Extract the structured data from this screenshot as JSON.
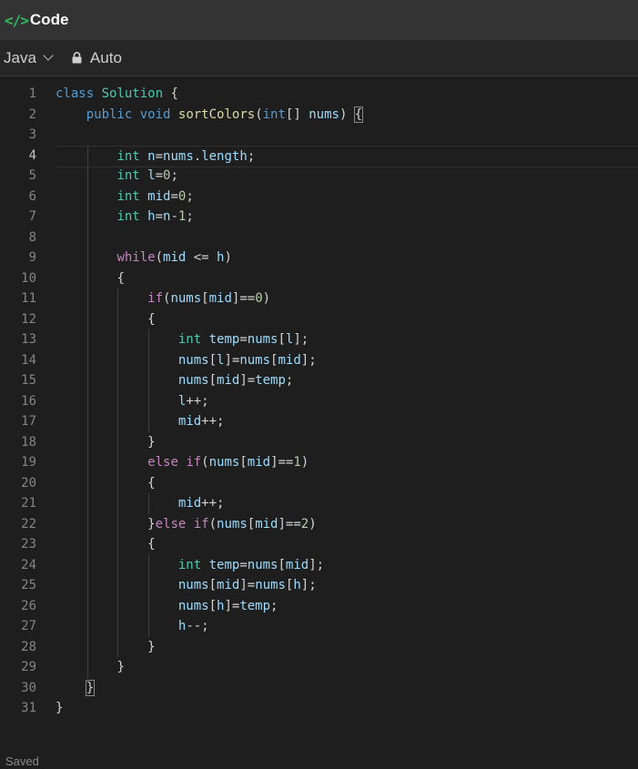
{
  "header": {
    "icon": "code-brackets-icon",
    "icon_glyph": "</>",
    "title": "Code"
  },
  "toolbar": {
    "language": "Java",
    "mode": "Auto"
  },
  "editor": {
    "active_line": 4,
    "lines": [
      {
        "n": "1",
        "indent": 0,
        "tokens": [
          [
            "kw",
            "class"
          ],
          [
            "plain",
            " "
          ],
          [
            "cls",
            "Solution"
          ],
          [
            "plain",
            " {"
          ]
        ]
      },
      {
        "n": "2",
        "indent": 1,
        "tokens": [
          [
            "kw",
            "public"
          ],
          [
            "plain",
            " "
          ],
          [
            "kw",
            "void"
          ],
          [
            "plain",
            " "
          ],
          [
            "fn",
            "sortColors"
          ],
          [
            "plain",
            "("
          ],
          [
            "kw",
            "int"
          ],
          [
            "plain",
            "[] "
          ],
          [
            "var",
            "nums"
          ],
          [
            "plain",
            ") "
          ],
          [
            "match",
            "{"
          ]
        ]
      },
      {
        "n": "3",
        "indent": 1,
        "tokens": []
      },
      {
        "n": "4",
        "indent": 2,
        "tokens": [
          [
            "type",
            "int"
          ],
          [
            "plain",
            " "
          ],
          [
            "var",
            "n"
          ],
          [
            "plain",
            "="
          ],
          [
            "var",
            "nums"
          ],
          [
            "plain",
            "."
          ],
          [
            "var",
            "length"
          ],
          [
            "plain",
            ";"
          ]
        ]
      },
      {
        "n": "5",
        "indent": 2,
        "tokens": [
          [
            "type",
            "int"
          ],
          [
            "plain",
            " "
          ],
          [
            "var",
            "l"
          ],
          [
            "plain",
            "="
          ],
          [
            "num",
            "0"
          ],
          [
            "plain",
            ";"
          ]
        ]
      },
      {
        "n": "6",
        "indent": 2,
        "tokens": [
          [
            "type",
            "int"
          ],
          [
            "plain",
            " "
          ],
          [
            "var",
            "mid"
          ],
          [
            "plain",
            "="
          ],
          [
            "num",
            "0"
          ],
          [
            "plain",
            ";"
          ]
        ]
      },
      {
        "n": "7",
        "indent": 2,
        "tokens": [
          [
            "type",
            "int"
          ],
          [
            "plain",
            " "
          ],
          [
            "var",
            "h"
          ],
          [
            "plain",
            "="
          ],
          [
            "var",
            "n"
          ],
          [
            "plain",
            "-"
          ],
          [
            "num",
            "1"
          ],
          [
            "plain",
            ";"
          ]
        ]
      },
      {
        "n": "8",
        "indent": 2,
        "tokens": []
      },
      {
        "n": "9",
        "indent": 2,
        "tokens": [
          [
            "ctl",
            "while"
          ],
          [
            "plain",
            "("
          ],
          [
            "var",
            "mid"
          ],
          [
            "plain",
            " <= "
          ],
          [
            "var",
            "h"
          ],
          [
            "plain",
            ")"
          ]
        ]
      },
      {
        "n": "10",
        "indent": 2,
        "tokens": [
          [
            "plain",
            "{"
          ]
        ]
      },
      {
        "n": "11",
        "indent": 3,
        "tokens": [
          [
            "ctl",
            "if"
          ],
          [
            "plain",
            "("
          ],
          [
            "var",
            "nums"
          ],
          [
            "plain",
            "["
          ],
          [
            "var",
            "mid"
          ],
          [
            "plain",
            "]=="
          ],
          [
            "num",
            "0"
          ],
          [
            "plain",
            ")"
          ]
        ]
      },
      {
        "n": "12",
        "indent": 3,
        "tokens": [
          [
            "plain",
            "{"
          ]
        ]
      },
      {
        "n": "13",
        "indent": 4,
        "tokens": [
          [
            "type",
            "int"
          ],
          [
            "plain",
            " "
          ],
          [
            "var",
            "temp"
          ],
          [
            "plain",
            "="
          ],
          [
            "var",
            "nums"
          ],
          [
            "plain",
            "["
          ],
          [
            "var",
            "l"
          ],
          [
            "plain",
            "];"
          ]
        ]
      },
      {
        "n": "14",
        "indent": 4,
        "tokens": [
          [
            "var",
            "nums"
          ],
          [
            "plain",
            "["
          ],
          [
            "var",
            "l"
          ],
          [
            "plain",
            "]="
          ],
          [
            "var",
            "nums"
          ],
          [
            "plain",
            "["
          ],
          [
            "var",
            "mid"
          ],
          [
            "plain",
            "];"
          ]
        ]
      },
      {
        "n": "15",
        "indent": 4,
        "tokens": [
          [
            "var",
            "nums"
          ],
          [
            "plain",
            "["
          ],
          [
            "var",
            "mid"
          ],
          [
            "plain",
            "]="
          ],
          [
            "var",
            "temp"
          ],
          [
            "plain",
            ";"
          ]
        ]
      },
      {
        "n": "16",
        "indent": 4,
        "tokens": [
          [
            "var",
            "l"
          ],
          [
            "plain",
            "++;"
          ]
        ]
      },
      {
        "n": "17",
        "indent": 4,
        "tokens": [
          [
            "var",
            "mid"
          ],
          [
            "plain",
            "++;"
          ]
        ]
      },
      {
        "n": "18",
        "indent": 3,
        "tokens": [
          [
            "plain",
            "}"
          ]
        ]
      },
      {
        "n": "19",
        "indent": 3,
        "tokens": [
          [
            "ctl",
            "else"
          ],
          [
            "plain",
            " "
          ],
          [
            "ctl",
            "if"
          ],
          [
            "plain",
            "("
          ],
          [
            "var",
            "nums"
          ],
          [
            "plain",
            "["
          ],
          [
            "var",
            "mid"
          ],
          [
            "plain",
            "]=="
          ],
          [
            "num",
            "1"
          ],
          [
            "plain",
            ")"
          ]
        ]
      },
      {
        "n": "20",
        "indent": 3,
        "tokens": [
          [
            "plain",
            "{"
          ]
        ]
      },
      {
        "n": "21",
        "indent": 4,
        "tokens": [
          [
            "var",
            "mid"
          ],
          [
            "plain",
            "++;"
          ]
        ]
      },
      {
        "n": "22",
        "indent": 3,
        "tokens": [
          [
            "plain",
            "}"
          ],
          [
            "ctl",
            "else"
          ],
          [
            "plain",
            " "
          ],
          [
            "ctl",
            "if"
          ],
          [
            "plain",
            "("
          ],
          [
            "var",
            "nums"
          ],
          [
            "plain",
            "["
          ],
          [
            "var",
            "mid"
          ],
          [
            "plain",
            "]=="
          ],
          [
            "num",
            "2"
          ],
          [
            "plain",
            ")"
          ]
        ]
      },
      {
        "n": "23",
        "indent": 3,
        "tokens": [
          [
            "plain",
            "{"
          ]
        ]
      },
      {
        "n": "24",
        "indent": 4,
        "tokens": [
          [
            "type",
            "int"
          ],
          [
            "plain",
            " "
          ],
          [
            "var",
            "temp"
          ],
          [
            "plain",
            "="
          ],
          [
            "var",
            "nums"
          ],
          [
            "plain",
            "["
          ],
          [
            "var",
            "mid"
          ],
          [
            "plain",
            "];"
          ]
        ]
      },
      {
        "n": "25",
        "indent": 4,
        "tokens": [
          [
            "var",
            "nums"
          ],
          [
            "plain",
            "["
          ],
          [
            "var",
            "mid"
          ],
          [
            "plain",
            "]="
          ],
          [
            "var",
            "nums"
          ],
          [
            "plain",
            "["
          ],
          [
            "var",
            "h"
          ],
          [
            "plain",
            "];"
          ]
        ]
      },
      {
        "n": "26",
        "indent": 4,
        "tokens": [
          [
            "var",
            "nums"
          ],
          [
            "plain",
            "["
          ],
          [
            "var",
            "h"
          ],
          [
            "plain",
            "]="
          ],
          [
            "var",
            "temp"
          ],
          [
            "plain",
            ";"
          ]
        ]
      },
      {
        "n": "27",
        "indent": 4,
        "tokens": [
          [
            "var",
            "h"
          ],
          [
            "plain",
            "--;"
          ]
        ]
      },
      {
        "n": "28",
        "indent": 3,
        "tokens": [
          [
            "plain",
            "}"
          ]
        ]
      },
      {
        "n": "29",
        "indent": 2,
        "tokens": [
          [
            "plain",
            "}"
          ]
        ]
      },
      {
        "n": "30",
        "indent": 1,
        "tokens": [
          [
            "match",
            "}"
          ]
        ]
      },
      {
        "n": "31",
        "indent": 0,
        "tokens": [
          [
            "plain",
            "}"
          ]
        ]
      }
    ]
  },
  "status": {
    "text": "Saved"
  }
}
